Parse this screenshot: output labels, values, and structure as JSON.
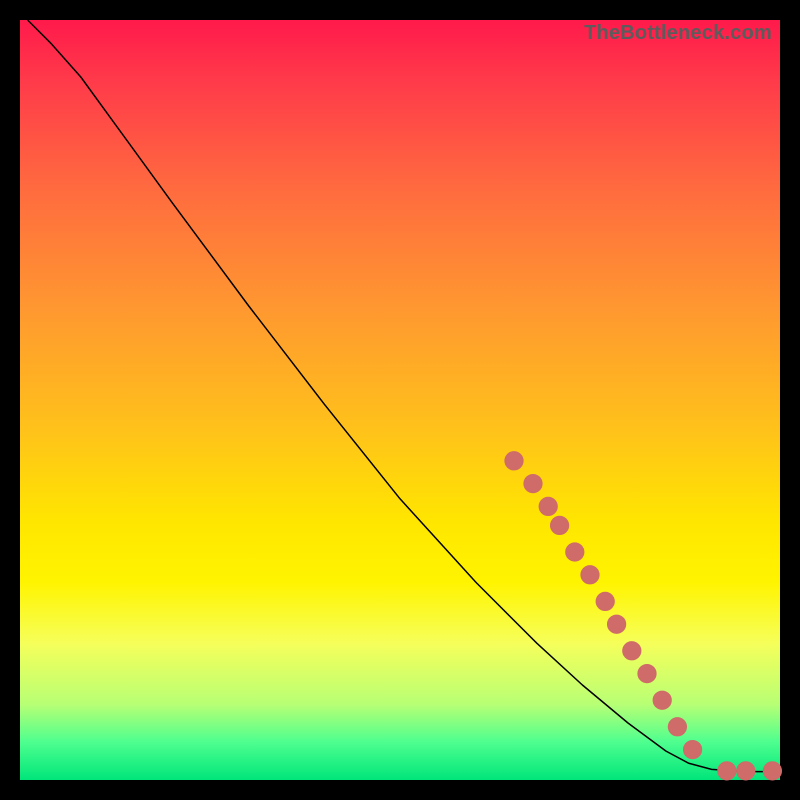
{
  "watermark": "TheBottleneck.com",
  "chart_data": {
    "type": "line",
    "title": "",
    "xlabel": "",
    "ylabel": "",
    "xlim": [
      0,
      100
    ],
    "ylim": [
      0,
      100
    ],
    "curve": [
      {
        "x": 1,
        "y": 100
      },
      {
        "x": 4,
        "y": 97
      },
      {
        "x": 8,
        "y": 92.5
      },
      {
        "x": 12,
        "y": 87
      },
      {
        "x": 20,
        "y": 76
      },
      {
        "x": 30,
        "y": 62.5
      },
      {
        "x": 40,
        "y": 49.5
      },
      {
        "x": 50,
        "y": 37
      },
      {
        "x": 60,
        "y": 26
      },
      {
        "x": 68,
        "y": 18
      },
      {
        "x": 74,
        "y": 12.5
      },
      {
        "x": 80,
        "y": 7.5
      },
      {
        "x": 85,
        "y": 3.8
      },
      {
        "x": 88,
        "y": 2.2
      },
      {
        "x": 91,
        "y": 1.4
      },
      {
        "x": 94,
        "y": 1.2
      },
      {
        "x": 97,
        "y": 1.1
      },
      {
        "x": 100,
        "y": 1.1
      }
    ],
    "markers": [
      {
        "x": 65.0,
        "y": 42.0
      },
      {
        "x": 67.5,
        "y": 39.0
      },
      {
        "x": 69.5,
        "y": 36.0
      },
      {
        "x": 71.0,
        "y": 33.5
      },
      {
        "x": 73.0,
        "y": 30.0
      },
      {
        "x": 75.0,
        "y": 27.0
      },
      {
        "x": 77.0,
        "y": 23.5
      },
      {
        "x": 78.5,
        "y": 20.5
      },
      {
        "x": 80.5,
        "y": 17.0
      },
      {
        "x": 82.5,
        "y": 14.0
      },
      {
        "x": 84.5,
        "y": 10.5
      },
      {
        "x": 86.5,
        "y": 7.0
      },
      {
        "x": 88.5,
        "y": 4.0
      },
      {
        "x": 93.0,
        "y": 1.2
      },
      {
        "x": 95.5,
        "y": 1.2
      },
      {
        "x": 99.0,
        "y": 1.2
      }
    ],
    "marker_radius_percent": 1.2,
    "colors": {
      "curve": "#000000",
      "marker": "#cf6b68",
      "gradient_top": "#ff1a4b",
      "gradient_bottom": "#00e57a"
    }
  }
}
